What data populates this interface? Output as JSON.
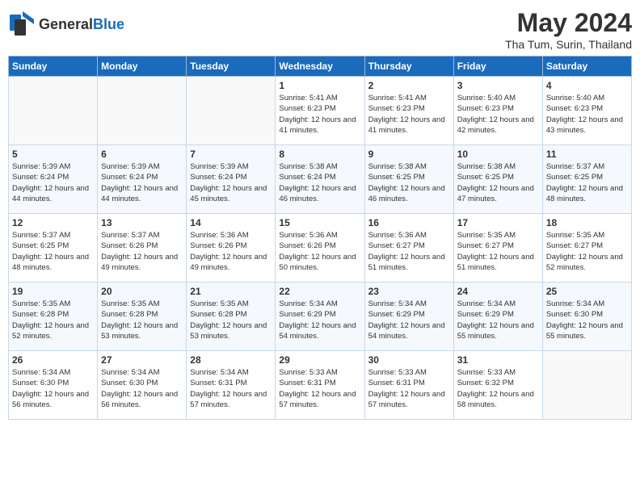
{
  "header": {
    "logo_general": "General",
    "logo_blue": "Blue",
    "month_year": "May 2024",
    "location": "Tha Tum, Surin, Thailand"
  },
  "weekdays": [
    "Sunday",
    "Monday",
    "Tuesday",
    "Wednesday",
    "Thursday",
    "Friday",
    "Saturday"
  ],
  "weeks": [
    [
      {
        "day": "",
        "sunrise": "",
        "sunset": "",
        "daylight": ""
      },
      {
        "day": "",
        "sunrise": "",
        "sunset": "",
        "daylight": ""
      },
      {
        "day": "",
        "sunrise": "",
        "sunset": "",
        "daylight": ""
      },
      {
        "day": "1",
        "sunrise": "Sunrise: 5:41 AM",
        "sunset": "Sunset: 6:23 PM",
        "daylight": "Daylight: 12 hours and 41 minutes."
      },
      {
        "day": "2",
        "sunrise": "Sunrise: 5:41 AM",
        "sunset": "Sunset: 6:23 PM",
        "daylight": "Daylight: 12 hours and 41 minutes."
      },
      {
        "day": "3",
        "sunrise": "Sunrise: 5:40 AM",
        "sunset": "Sunset: 6:23 PM",
        "daylight": "Daylight: 12 hours and 42 minutes."
      },
      {
        "day": "4",
        "sunrise": "Sunrise: 5:40 AM",
        "sunset": "Sunset: 6:23 PM",
        "daylight": "Daylight: 12 hours and 43 minutes."
      }
    ],
    [
      {
        "day": "5",
        "sunrise": "Sunrise: 5:39 AM",
        "sunset": "Sunset: 6:24 PM",
        "daylight": "Daylight: 12 hours and 44 minutes."
      },
      {
        "day": "6",
        "sunrise": "Sunrise: 5:39 AM",
        "sunset": "Sunset: 6:24 PM",
        "daylight": "Daylight: 12 hours and 44 minutes."
      },
      {
        "day": "7",
        "sunrise": "Sunrise: 5:39 AM",
        "sunset": "Sunset: 6:24 PM",
        "daylight": "Daylight: 12 hours and 45 minutes."
      },
      {
        "day": "8",
        "sunrise": "Sunrise: 5:38 AM",
        "sunset": "Sunset: 6:24 PM",
        "daylight": "Daylight: 12 hours and 46 minutes."
      },
      {
        "day": "9",
        "sunrise": "Sunrise: 5:38 AM",
        "sunset": "Sunset: 6:25 PM",
        "daylight": "Daylight: 12 hours and 46 minutes."
      },
      {
        "day": "10",
        "sunrise": "Sunrise: 5:38 AM",
        "sunset": "Sunset: 6:25 PM",
        "daylight": "Daylight: 12 hours and 47 minutes."
      },
      {
        "day": "11",
        "sunrise": "Sunrise: 5:37 AM",
        "sunset": "Sunset: 6:25 PM",
        "daylight": "Daylight: 12 hours and 48 minutes."
      }
    ],
    [
      {
        "day": "12",
        "sunrise": "Sunrise: 5:37 AM",
        "sunset": "Sunset: 6:25 PM",
        "daylight": "Daylight: 12 hours and 48 minutes."
      },
      {
        "day": "13",
        "sunrise": "Sunrise: 5:37 AM",
        "sunset": "Sunset: 6:26 PM",
        "daylight": "Daylight: 12 hours and 49 minutes."
      },
      {
        "day": "14",
        "sunrise": "Sunrise: 5:36 AM",
        "sunset": "Sunset: 6:26 PM",
        "daylight": "Daylight: 12 hours and 49 minutes."
      },
      {
        "day": "15",
        "sunrise": "Sunrise: 5:36 AM",
        "sunset": "Sunset: 6:26 PM",
        "daylight": "Daylight: 12 hours and 50 minutes."
      },
      {
        "day": "16",
        "sunrise": "Sunrise: 5:36 AM",
        "sunset": "Sunset: 6:27 PM",
        "daylight": "Daylight: 12 hours and 51 minutes."
      },
      {
        "day": "17",
        "sunrise": "Sunrise: 5:35 AM",
        "sunset": "Sunset: 6:27 PM",
        "daylight": "Daylight: 12 hours and 51 minutes."
      },
      {
        "day": "18",
        "sunrise": "Sunrise: 5:35 AM",
        "sunset": "Sunset: 6:27 PM",
        "daylight": "Daylight: 12 hours and 52 minutes."
      }
    ],
    [
      {
        "day": "19",
        "sunrise": "Sunrise: 5:35 AM",
        "sunset": "Sunset: 6:28 PM",
        "daylight": "Daylight: 12 hours and 52 minutes."
      },
      {
        "day": "20",
        "sunrise": "Sunrise: 5:35 AM",
        "sunset": "Sunset: 6:28 PM",
        "daylight": "Daylight: 12 hours and 53 minutes."
      },
      {
        "day": "21",
        "sunrise": "Sunrise: 5:35 AM",
        "sunset": "Sunset: 6:28 PM",
        "daylight": "Daylight: 12 hours and 53 minutes."
      },
      {
        "day": "22",
        "sunrise": "Sunrise: 5:34 AM",
        "sunset": "Sunset: 6:29 PM",
        "daylight": "Daylight: 12 hours and 54 minutes."
      },
      {
        "day": "23",
        "sunrise": "Sunrise: 5:34 AM",
        "sunset": "Sunset: 6:29 PM",
        "daylight": "Daylight: 12 hours and 54 minutes."
      },
      {
        "day": "24",
        "sunrise": "Sunrise: 5:34 AM",
        "sunset": "Sunset: 6:29 PM",
        "daylight": "Daylight: 12 hours and 55 minutes."
      },
      {
        "day": "25",
        "sunrise": "Sunrise: 5:34 AM",
        "sunset": "Sunset: 6:30 PM",
        "daylight": "Daylight: 12 hours and 55 minutes."
      }
    ],
    [
      {
        "day": "26",
        "sunrise": "Sunrise: 5:34 AM",
        "sunset": "Sunset: 6:30 PM",
        "daylight": "Daylight: 12 hours and 56 minutes."
      },
      {
        "day": "27",
        "sunrise": "Sunrise: 5:34 AM",
        "sunset": "Sunset: 6:30 PM",
        "daylight": "Daylight: 12 hours and 56 minutes."
      },
      {
        "day": "28",
        "sunrise": "Sunrise: 5:34 AM",
        "sunset": "Sunset: 6:31 PM",
        "daylight": "Daylight: 12 hours and 57 minutes."
      },
      {
        "day": "29",
        "sunrise": "Sunrise: 5:33 AM",
        "sunset": "Sunset: 6:31 PM",
        "daylight": "Daylight: 12 hours and 57 minutes."
      },
      {
        "day": "30",
        "sunrise": "Sunrise: 5:33 AM",
        "sunset": "Sunset: 6:31 PM",
        "daylight": "Daylight: 12 hours and 57 minutes."
      },
      {
        "day": "31",
        "sunrise": "Sunrise: 5:33 AM",
        "sunset": "Sunset: 6:32 PM",
        "daylight": "Daylight: 12 hours and 58 minutes."
      },
      {
        "day": "",
        "sunrise": "",
        "sunset": "",
        "daylight": ""
      }
    ]
  ]
}
